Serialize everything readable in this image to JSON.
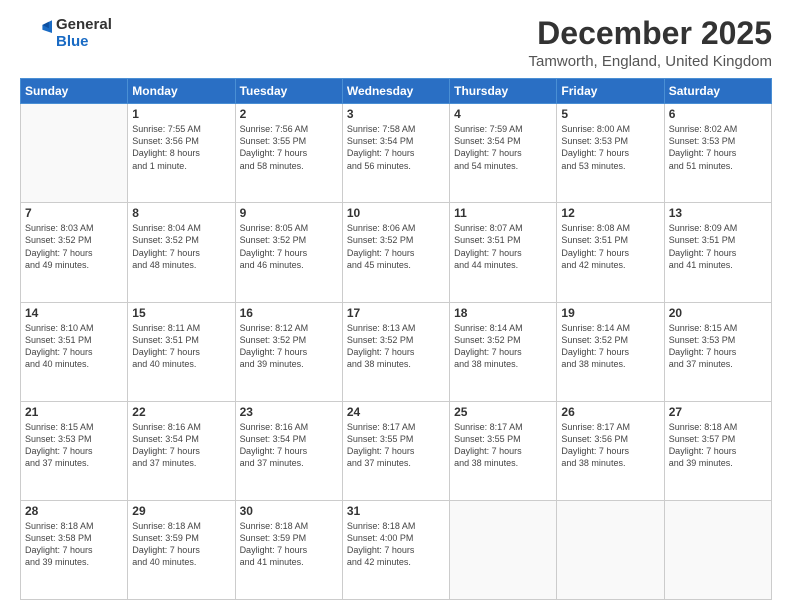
{
  "header": {
    "logo_line1": "General",
    "logo_line2": "Blue",
    "month": "December 2025",
    "location": "Tamworth, England, United Kingdom"
  },
  "weekdays": [
    "Sunday",
    "Monday",
    "Tuesday",
    "Wednesday",
    "Thursday",
    "Friday",
    "Saturday"
  ],
  "weeks": [
    [
      {
        "day": "",
        "content": ""
      },
      {
        "day": "1",
        "content": "Sunrise: 7:55 AM\nSunset: 3:56 PM\nDaylight: 8 hours\nand 1 minute."
      },
      {
        "day": "2",
        "content": "Sunrise: 7:56 AM\nSunset: 3:55 PM\nDaylight: 7 hours\nand 58 minutes."
      },
      {
        "day": "3",
        "content": "Sunrise: 7:58 AM\nSunset: 3:54 PM\nDaylight: 7 hours\nand 56 minutes."
      },
      {
        "day": "4",
        "content": "Sunrise: 7:59 AM\nSunset: 3:54 PM\nDaylight: 7 hours\nand 54 minutes."
      },
      {
        "day": "5",
        "content": "Sunrise: 8:00 AM\nSunset: 3:53 PM\nDaylight: 7 hours\nand 53 minutes."
      },
      {
        "day": "6",
        "content": "Sunrise: 8:02 AM\nSunset: 3:53 PM\nDaylight: 7 hours\nand 51 minutes."
      }
    ],
    [
      {
        "day": "7",
        "content": "Sunrise: 8:03 AM\nSunset: 3:52 PM\nDaylight: 7 hours\nand 49 minutes."
      },
      {
        "day": "8",
        "content": "Sunrise: 8:04 AM\nSunset: 3:52 PM\nDaylight: 7 hours\nand 48 minutes."
      },
      {
        "day": "9",
        "content": "Sunrise: 8:05 AM\nSunset: 3:52 PM\nDaylight: 7 hours\nand 46 minutes."
      },
      {
        "day": "10",
        "content": "Sunrise: 8:06 AM\nSunset: 3:52 PM\nDaylight: 7 hours\nand 45 minutes."
      },
      {
        "day": "11",
        "content": "Sunrise: 8:07 AM\nSunset: 3:51 PM\nDaylight: 7 hours\nand 44 minutes."
      },
      {
        "day": "12",
        "content": "Sunrise: 8:08 AM\nSunset: 3:51 PM\nDaylight: 7 hours\nand 42 minutes."
      },
      {
        "day": "13",
        "content": "Sunrise: 8:09 AM\nSunset: 3:51 PM\nDaylight: 7 hours\nand 41 minutes."
      }
    ],
    [
      {
        "day": "14",
        "content": "Sunrise: 8:10 AM\nSunset: 3:51 PM\nDaylight: 7 hours\nand 40 minutes."
      },
      {
        "day": "15",
        "content": "Sunrise: 8:11 AM\nSunset: 3:51 PM\nDaylight: 7 hours\nand 40 minutes."
      },
      {
        "day": "16",
        "content": "Sunrise: 8:12 AM\nSunset: 3:52 PM\nDaylight: 7 hours\nand 39 minutes."
      },
      {
        "day": "17",
        "content": "Sunrise: 8:13 AM\nSunset: 3:52 PM\nDaylight: 7 hours\nand 38 minutes."
      },
      {
        "day": "18",
        "content": "Sunrise: 8:14 AM\nSunset: 3:52 PM\nDaylight: 7 hours\nand 38 minutes."
      },
      {
        "day": "19",
        "content": "Sunrise: 8:14 AM\nSunset: 3:52 PM\nDaylight: 7 hours\nand 38 minutes."
      },
      {
        "day": "20",
        "content": "Sunrise: 8:15 AM\nSunset: 3:53 PM\nDaylight: 7 hours\nand 37 minutes."
      }
    ],
    [
      {
        "day": "21",
        "content": "Sunrise: 8:15 AM\nSunset: 3:53 PM\nDaylight: 7 hours\nand 37 minutes."
      },
      {
        "day": "22",
        "content": "Sunrise: 8:16 AM\nSunset: 3:54 PM\nDaylight: 7 hours\nand 37 minutes."
      },
      {
        "day": "23",
        "content": "Sunrise: 8:16 AM\nSunset: 3:54 PM\nDaylight: 7 hours\nand 37 minutes."
      },
      {
        "day": "24",
        "content": "Sunrise: 8:17 AM\nSunset: 3:55 PM\nDaylight: 7 hours\nand 37 minutes."
      },
      {
        "day": "25",
        "content": "Sunrise: 8:17 AM\nSunset: 3:55 PM\nDaylight: 7 hours\nand 38 minutes."
      },
      {
        "day": "26",
        "content": "Sunrise: 8:17 AM\nSunset: 3:56 PM\nDaylight: 7 hours\nand 38 minutes."
      },
      {
        "day": "27",
        "content": "Sunrise: 8:18 AM\nSunset: 3:57 PM\nDaylight: 7 hours\nand 39 minutes."
      }
    ],
    [
      {
        "day": "28",
        "content": "Sunrise: 8:18 AM\nSunset: 3:58 PM\nDaylight: 7 hours\nand 39 minutes."
      },
      {
        "day": "29",
        "content": "Sunrise: 8:18 AM\nSunset: 3:59 PM\nDaylight: 7 hours\nand 40 minutes."
      },
      {
        "day": "30",
        "content": "Sunrise: 8:18 AM\nSunset: 3:59 PM\nDaylight: 7 hours\nand 41 minutes."
      },
      {
        "day": "31",
        "content": "Sunrise: 8:18 AM\nSunset: 4:00 PM\nDaylight: 7 hours\nand 42 minutes."
      },
      {
        "day": "",
        "content": ""
      },
      {
        "day": "",
        "content": ""
      },
      {
        "day": "",
        "content": ""
      }
    ]
  ]
}
